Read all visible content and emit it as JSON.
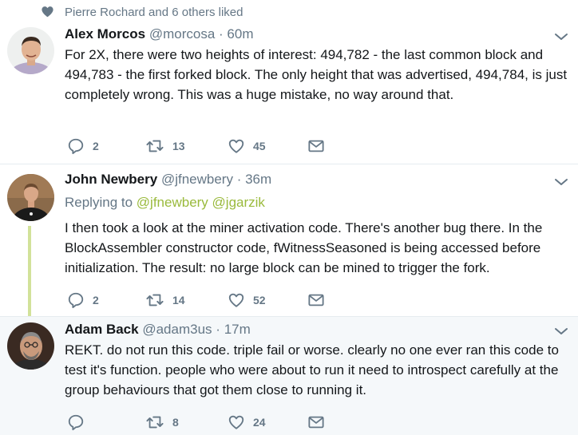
{
  "liked_by": {
    "icon": "heart-icon",
    "text": "Pierre Rochard and 6 others liked"
  },
  "tweets": [
    {
      "name": "Alex Morcos",
      "handle": "@morcosa",
      "dot": "·",
      "time": "60m",
      "text": "For 2X, there were two heights of interest: 494,782 - the last common block and 494,783 - the first forked block.  The only height that was advertised, 494,784, is just completely wrong. This was a huge mistake, no way around that.",
      "replies": "2",
      "retweets": "13",
      "likes": "45"
    },
    {
      "name": "John Newbery",
      "handle": "@jfnewbery",
      "dot": "·",
      "time": "36m",
      "replying_label": "Replying to",
      "replying_mentions": [
        "@jfnewbery",
        "@jgarzik"
      ],
      "text": "I then took a look at the miner activation code. There's another bug there. In the BlockAssembler constructor code, fWitnessSeasoned is being accessed before initialization. The result: no large block can be mined to trigger the fork.",
      "replies": "2",
      "retweets": "14",
      "likes": "52"
    },
    {
      "name": "Adam Back",
      "handle": "@adam3us",
      "dot": "·",
      "time": "17m",
      "text": "REKT. do not run this code. triple fail or worse. clearly no one ever ran this code to test it's function. people who were about to run it need to introspect carefully at the group behaviours that got them close to running it.",
      "replies": "",
      "retweets": "8",
      "likes": "24"
    }
  ],
  "colors": {
    "text": "#14171a",
    "secondary": "#657786",
    "mention": "#9aba3c",
    "thread_line": "#d2e29a",
    "highlight_bg": "#f5f8fa"
  }
}
